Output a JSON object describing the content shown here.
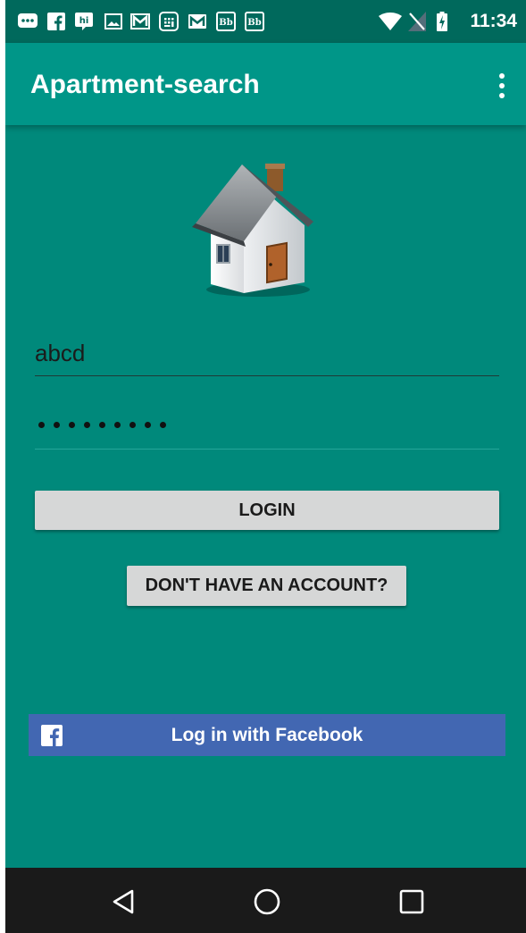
{
  "status_bar": {
    "time": "11:34",
    "icons": [
      "chat-bubble-icon",
      "facebook-icon",
      "hi-icon",
      "image-icon",
      "gmail-icon",
      "calculator-icon",
      "gmail-icon",
      "blackboard-icon",
      "blackboard-icon",
      "wifi-icon",
      "no-sim-icon",
      "battery-charging-icon"
    ]
  },
  "app_bar": {
    "title": "Apartment-search",
    "menu_icon": "more-vert-icon"
  },
  "logo": {
    "icon": "house-icon"
  },
  "form": {
    "username_value": "abcd",
    "password_masked": "•••••••••",
    "password_length": 9
  },
  "buttons": {
    "login": "LOGIN",
    "no_account": "DON'T HAVE AN ACCOUNT?",
    "facebook": "Log in with Facebook"
  },
  "colors": {
    "primary": "#009688",
    "primary_dark": "#00695c",
    "background": "#00897b",
    "facebook": "#4267b2"
  },
  "nav_bar": {
    "icons": [
      "back-icon",
      "home-icon",
      "recents-icon"
    ]
  }
}
